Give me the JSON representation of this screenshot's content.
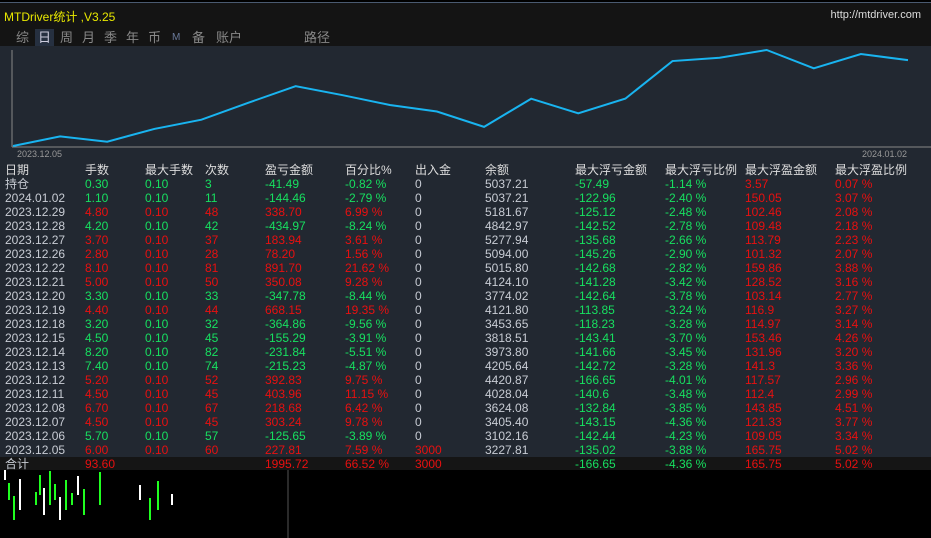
{
  "app": {
    "title": "MTDriver统计 ,V3.25",
    "url": "http://mtdriver.com"
  },
  "tabs": [
    {
      "label": "综"
    },
    {
      "label": "日",
      "active": true
    },
    {
      "label": "周"
    },
    {
      "label": "月"
    },
    {
      "label": "季"
    },
    {
      "label": "年"
    },
    {
      "label": "币"
    },
    {
      "label": "M"
    },
    {
      "label": "备"
    },
    {
      "label": "账户"
    },
    {
      "label": "路径"
    }
  ],
  "chart": {
    "start_label": "2023.12.05",
    "end_label": "2024.01.02",
    "line_color": "#19b4f0",
    "balances": [
      3000,
      3227.81,
      3102.16,
      3405.4,
      3624.08,
      4028.04,
      4420.87,
      4205.64,
      3973.8,
      3818.51,
      3453.65,
      4121.8,
      3774.02,
      4124.1,
      5015.8,
      5094.0,
      5277.94,
      4842.97,
      5181.67,
      5037.21
    ]
  },
  "columns": [
    "日期",
    "手数",
    "最大手数",
    "次数",
    "盈亏金额",
    "百分比%",
    "出入金",
    "余额",
    "最大浮亏金额",
    "最大浮亏比例",
    "最大浮盈金额",
    "最大浮盈比例"
  ],
  "rows": [
    [
      "持仓",
      "0.30",
      "0.10",
      "3",
      "-41.49",
      "-0.82 %",
      "0",
      "5037.21",
      "-57.49",
      "-1.14 %",
      "3.57",
      "0.07 %"
    ],
    [
      "2024.01.02",
      "1.10",
      "0.10",
      "11",
      "-144.46",
      "-2.79 %",
      "0",
      "5037.21",
      "-122.96",
      "-2.40 %",
      "150.05",
      "3.07 %"
    ],
    [
      "2023.12.29",
      "4.80",
      "0.10",
      "48",
      "338.70",
      "6.99 %",
      "0",
      "5181.67",
      "-125.12",
      "-2.48 %",
      "102.46",
      "2.08 %"
    ],
    [
      "2023.12.28",
      "4.20",
      "0.10",
      "42",
      "-434.97",
      "-8.24 %",
      "0",
      "4842.97",
      "-142.52",
      "-2.78 %",
      "109.48",
      "2.18 %"
    ],
    [
      "2023.12.27",
      "3.70",
      "0.10",
      "37",
      "183.94",
      "3.61 %",
      "0",
      "5277.94",
      "-135.68",
      "-2.66 %",
      "113.79",
      "2.23 %"
    ],
    [
      "2023.12.26",
      "2.80",
      "0.10",
      "28",
      "78.20",
      "1.56 %",
      "0",
      "5094.00",
      "-145.26",
      "-2.90 %",
      "101.32",
      "2.07 %"
    ],
    [
      "2023.12.22",
      "8.10",
      "0.10",
      "81",
      "891.70",
      "21.62 %",
      "0",
      "5015.80",
      "-142.68",
      "-2.82 %",
      "159.86",
      "3.88 %"
    ],
    [
      "2023.12.21",
      "5.00",
      "0.10",
      "50",
      "350.08",
      "9.28 %",
      "0",
      "4124.10",
      "-141.28",
      "-3.42 %",
      "128.52",
      "3.16 %"
    ],
    [
      "2023.12.20",
      "3.30",
      "0.10",
      "33",
      "-347.78",
      "-8.44 %",
      "0",
      "3774.02",
      "-142.64",
      "-3.78 %",
      "103.14",
      "2.77 %"
    ],
    [
      "2023.12.19",
      "4.40",
      "0.10",
      "44",
      "668.15",
      "19.35 %",
      "0",
      "4121.80",
      "-113.85",
      "-3.24 %",
      "116.9",
      "3.27 %"
    ],
    [
      "2023.12.18",
      "3.20",
      "0.10",
      "32",
      "-364.86",
      "-9.56 %",
      "0",
      "3453.65",
      "-118.23",
      "-3.28 %",
      "114.97",
      "3.14 %"
    ],
    [
      "2023.12.15",
      "4.50",
      "0.10",
      "45",
      "-155.29",
      "-3.91 %",
      "0",
      "3818.51",
      "-143.41",
      "-3.70 %",
      "153.46",
      "4.26 %"
    ],
    [
      "2023.12.14",
      "8.20",
      "0.10",
      "82",
      "-231.84",
      "-5.51 %",
      "0",
      "3973.80",
      "-141.66",
      "-3.45 %",
      "131.96",
      "3.20 %"
    ],
    [
      "2023.12.13",
      "7.40",
      "0.10",
      "74",
      "-215.23",
      "-4.87 %",
      "0",
      "4205.64",
      "-142.72",
      "-3.28 %",
      "141.3",
      "3.36 %"
    ],
    [
      "2023.12.12",
      "5.20",
      "0.10",
      "52",
      "392.83",
      "9.75 %",
      "0",
      "4420.87",
      "-166.65",
      "-4.01 %",
      "117.57",
      "2.96 %"
    ],
    [
      "2023.12.11",
      "4.50",
      "0.10",
      "45",
      "403.96",
      "11.15 %",
      "0",
      "4028.04",
      "-140.6",
      "-3.48 %",
      "112.4",
      "2.99 %"
    ],
    [
      "2023.12.08",
      "6.70",
      "0.10",
      "67",
      "218.68",
      "6.42 %",
      "0",
      "3624.08",
      "-132.84",
      "-3.85 %",
      "143.85",
      "4.51 %"
    ],
    [
      "2023.12.07",
      "4.50",
      "0.10",
      "45",
      "303.24",
      "9.78 %",
      "0",
      "3405.40",
      "-143.15",
      "-4.36 %",
      "121.33",
      "3.77 %"
    ],
    [
      "2023.12.06",
      "5.70",
      "0.10",
      "57",
      "-125.65",
      "-3.89 %",
      "0",
      "3102.16",
      "-142.44",
      "-4.23 %",
      "109.05",
      "3.34 %"
    ],
    [
      "2023.12.05",
      "6.00",
      "0.10",
      "60",
      "227.81",
      "7.59 %",
      "3000",
      "3227.81",
      "-135.02",
      "-3.88 %",
      "165.75",
      "5.02 %"
    ]
  ],
  "total": [
    "合计",
    "93.60",
    "",
    "",
    "1995.72",
    "66.52 %",
    "3000",
    "",
    "-166.65",
    "-4.36 %",
    "165.75",
    "5.02 %"
  ],
  "colors": {
    "profit": "#e81010",
    "loss": "#17e060",
    "text": "#c8ccd4"
  }
}
